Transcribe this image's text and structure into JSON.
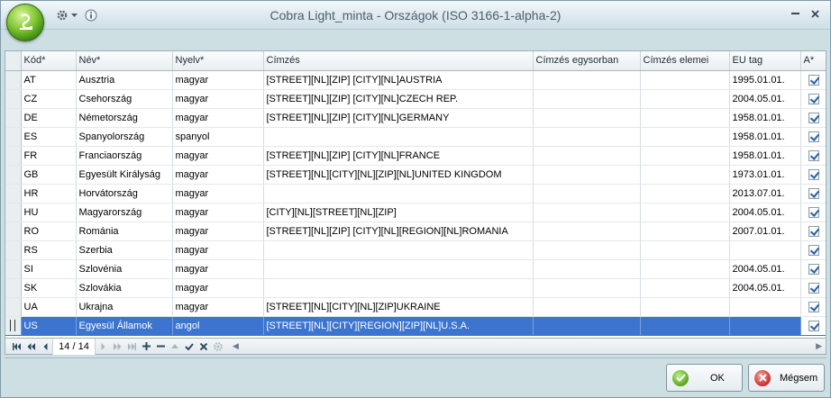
{
  "window": {
    "title": "Cobra Light_minta - Országok (ISO 3166-1-alpha-2)"
  },
  "grid": {
    "columns": [
      "Kód*",
      "Név*",
      "Nyelv*",
      "Címzés",
      "Címzés egysorban",
      "Címzés elemei",
      "EU tag",
      "A*"
    ],
    "rows": [
      {
        "kod": "AT",
        "nev": "Ausztria",
        "nyelv": "magyar",
        "cimzes": "[STREET][NL][ZIP] [CITY][NL]AUSTRIA",
        "egysor": "",
        "elemei": "",
        "eu": "1995.01.01.",
        "a": true
      },
      {
        "kod": "CZ",
        "nev": "Csehország",
        "nyelv": "magyar",
        "cimzes": "[STREET][NL][ZIP] [CITY][NL]CZECH REP.",
        "egysor": "",
        "elemei": "",
        "eu": "2004.05.01.",
        "a": true
      },
      {
        "kod": "DE",
        "nev": "Németország",
        "nyelv": "magyar",
        "cimzes": "[STREET][NL][ZIP] [CITY][NL]GERMANY",
        "egysor": "",
        "elemei": "",
        "eu": "1958.01.01.",
        "a": true
      },
      {
        "kod": "ES",
        "nev": "Spanyolország",
        "nyelv": "spanyol",
        "cimzes": "",
        "egysor": "",
        "elemei": "",
        "eu": "1958.01.01.",
        "a": true
      },
      {
        "kod": "FR",
        "nev": "Franciaország",
        "nyelv": "magyar",
        "cimzes": "[STREET][NL][ZIP] [CITY][NL]FRANCE",
        "egysor": "",
        "elemei": "",
        "eu": "1958.01.01.",
        "a": true
      },
      {
        "kod": "GB",
        "nev": "Egyesült Királyság",
        "nyelv": "magyar",
        "cimzes": "[STREET][NL][CITY][NL][ZIP][NL]UNITED KINGDOM",
        "egysor": "",
        "elemei": "",
        "eu": "1973.01.01.",
        "a": true
      },
      {
        "kod": "HR",
        "nev": "Horvátország",
        "nyelv": "magyar",
        "cimzes": "",
        "egysor": "",
        "elemei": "",
        "eu": "2013.07.01.",
        "a": true
      },
      {
        "kod": "HU",
        "nev": "Magyarország",
        "nyelv": "magyar",
        "cimzes": "[CITY][NL][STREET][NL][ZIP]",
        "egysor": "",
        "elemei": "",
        "eu": "2004.05.01.",
        "a": true
      },
      {
        "kod": "RO",
        "nev": "Románia",
        "nyelv": "magyar",
        "cimzes": "[STREET][NL][ZIP] [CITY][NL][REGION][NL]ROMANIA",
        "egysor": "",
        "elemei": "",
        "eu": "2007.01.01.",
        "a": true
      },
      {
        "kod": "RS",
        "nev": "Szerbia",
        "nyelv": "magyar",
        "cimzes": "",
        "egysor": "",
        "elemei": "",
        "eu": "",
        "a": true
      },
      {
        "kod": "SI",
        "nev": "Szlovénia",
        "nyelv": "magyar",
        "cimzes": "",
        "egysor": "",
        "elemei": "",
        "eu": "2004.05.01.",
        "a": true
      },
      {
        "kod": "SK",
        "nev": "Szlovákia",
        "nyelv": "magyar",
        "cimzes": "",
        "egysor": "",
        "elemei": "",
        "eu": "2004.05.01.",
        "a": true
      },
      {
        "kod": "UA",
        "nev": "Ukrajna",
        "nyelv": "magyar",
        "cimzes": "[STREET][NL][CITY][NL][ZIP]UKRAINE",
        "egysor": "",
        "elemei": "",
        "eu": "",
        "a": true
      },
      {
        "kod": "US",
        "nev": "Egyesül Államok",
        "nyelv": "angol",
        "cimzes": "[STREET][NL][CITY][REGION][ZIP][NL]U.S.A.",
        "egysor": "",
        "elemei": "",
        "eu": "",
        "a": true,
        "selected": true
      }
    ]
  },
  "navigator": {
    "position": "14 / 14"
  },
  "buttons": {
    "ok": "OK",
    "cancel": "Mégsem"
  },
  "colors": {
    "selection": "#3c74cf",
    "accent_green": "#5aa61e",
    "cancel_red": "#c8302c"
  },
  "icons": [
    "app-orb-icon",
    "gear-icon",
    "dropdown-arrow-icon",
    "info-icon",
    "minimize-icon",
    "close-icon",
    "first-record-icon",
    "prev-page-icon",
    "prev-record-icon",
    "next-record-icon",
    "next-page-icon",
    "last-record-icon",
    "add-icon",
    "delete-icon",
    "up-icon",
    "confirm-icon",
    "cancel-edit-icon",
    "gear-icon",
    "ok-check-icon",
    "cancel-x-icon"
  ]
}
